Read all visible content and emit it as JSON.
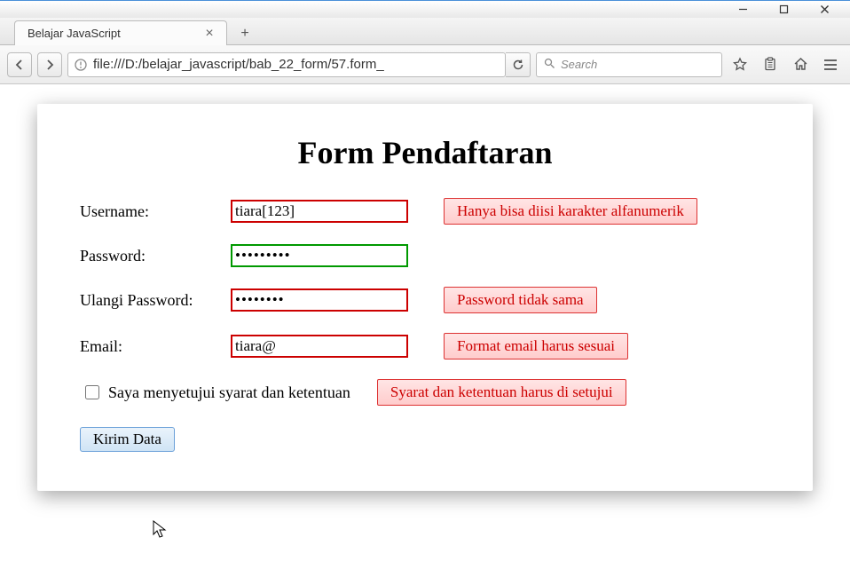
{
  "window": {
    "tab_title": "Belajar JavaScript",
    "url": "file:///D:/belajar_javascript/bab_22_form/57.form_",
    "search_placeholder": "Search"
  },
  "page": {
    "heading": "Form Pendaftaran",
    "fields": {
      "username": {
        "label": "Username:",
        "value": "tiara[123]",
        "error": "Hanya bisa diisi karakter alfanumerik"
      },
      "password": {
        "label": "Password:",
        "value": "•••••••••"
      },
      "password_repeat": {
        "label": "Ulangi Password:",
        "value": "••••••••",
        "error": "Password tidak sama"
      },
      "email": {
        "label": "Email:",
        "value": "tiara@",
        "error": "Format email harus sesuai"
      }
    },
    "terms": {
      "label": "Saya menyetujui syarat dan ketentuan",
      "error": "Syarat dan ketentuan harus di setujui"
    },
    "submit_label": "Kirim Data"
  }
}
